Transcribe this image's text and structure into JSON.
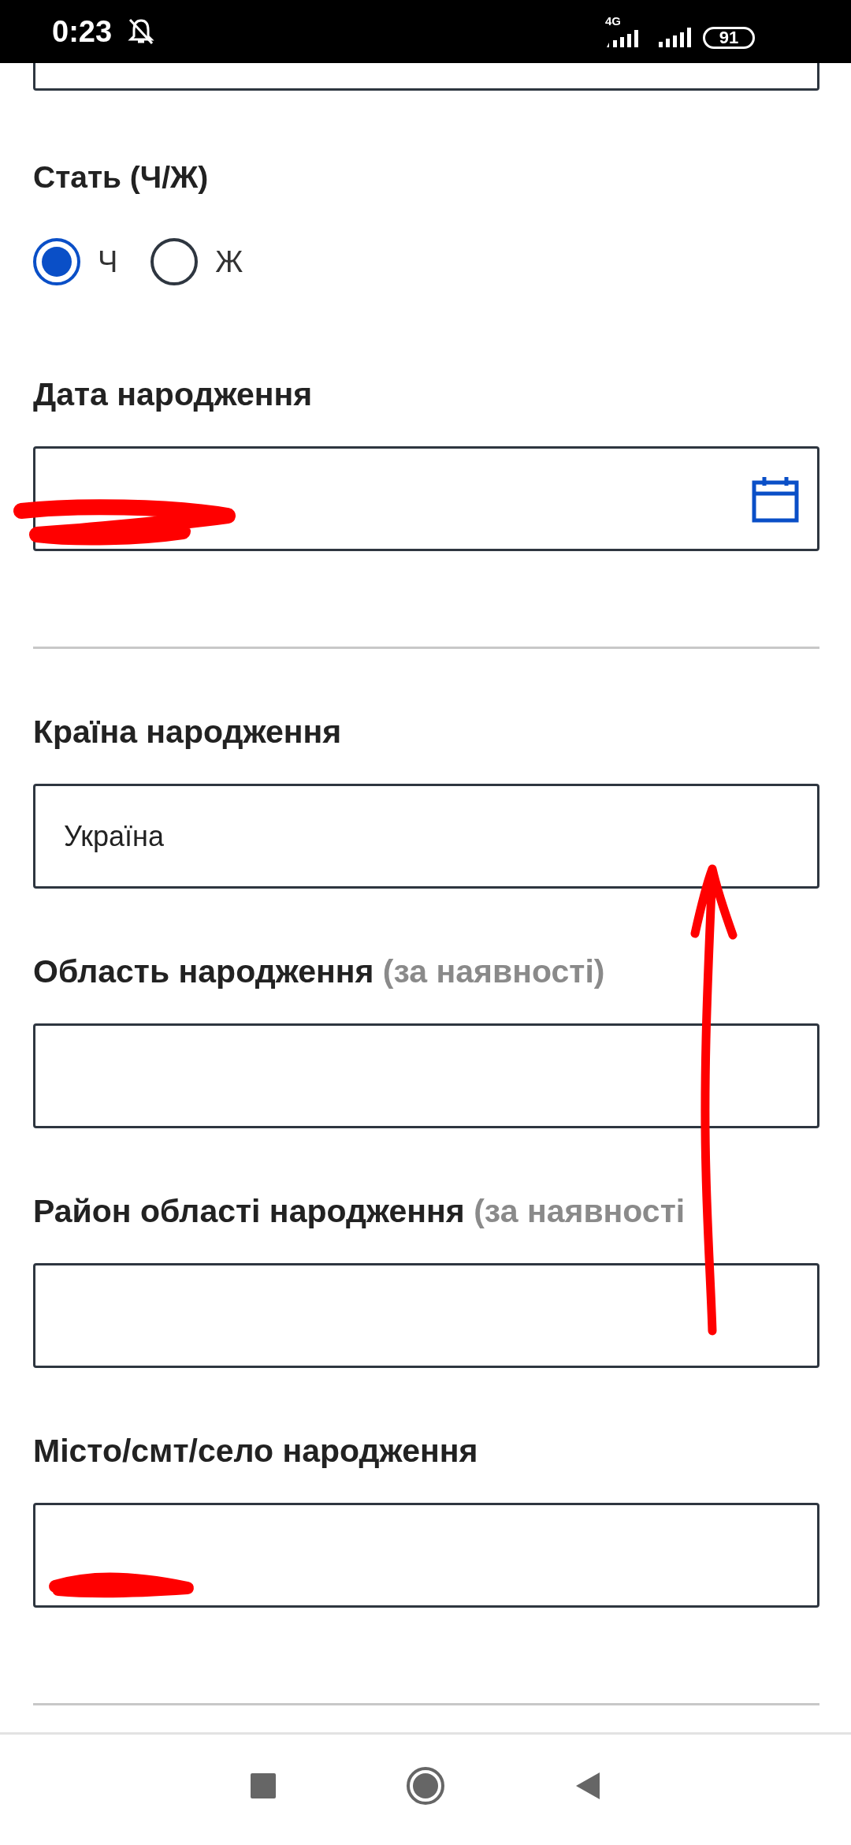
{
  "status_bar": {
    "time": "0:23",
    "network": "4G",
    "battery": "91"
  },
  "top_field": {
    "kind": "input"
  },
  "sex": {
    "label": "Стать (Ч/Ж)",
    "options": [
      {
        "label": "Ч",
        "selected": true
      },
      {
        "label": "Ж",
        "selected": false
      }
    ]
  },
  "fields": [
    {
      "label": "Дата народження",
      "kind": "date",
      "redacted": true,
      "divider_after": true
    },
    {
      "label": "Країна народження",
      "value": "Україна",
      "kind": "text",
      "redacted": false,
      "divider_after": false
    },
    {
      "label": "Область народження",
      "hint": "(за наявності)",
      "kind": "text",
      "redacted": false,
      "divider_after": false
    },
    {
      "label": "Район області народження",
      "hint": "(за наявності",
      "kind": "text",
      "redacted": false,
      "divider_after": false
    },
    {
      "label": "Місто/смт/село народження",
      "kind": "text",
      "redacted": true,
      "divider_after": true
    }
  ],
  "annotations": [
    {
      "kind": "arrow"
    }
  ],
  "nav_bar": {
    "buttons": [
      {
        "kind": "recents"
      },
      {
        "kind": "home"
      },
      {
        "kind": "back"
      }
    ]
  }
}
